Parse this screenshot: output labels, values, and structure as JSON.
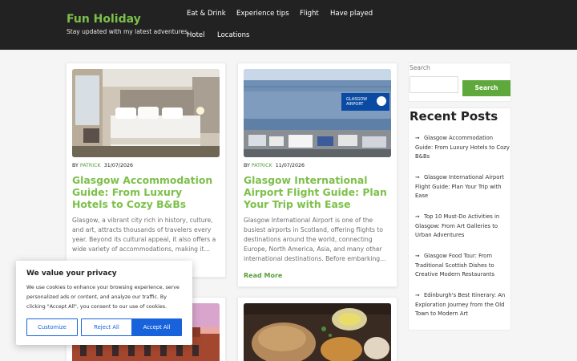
{
  "site": {
    "title": "Fun Holiday",
    "tagline": "Stay updated with my latest adventures."
  },
  "nav": {
    "items": [
      "Eat & Drink",
      "Experience tips",
      "Flight",
      "Have played",
      "Hotel",
      "Locations"
    ]
  },
  "posts": [
    {
      "by": "BY",
      "author": "PATRICK",
      "date": "31/07/2026",
      "title": "Glasgow Accommodation Guide: From Luxury Hotels to Cozy B&Bs",
      "excerpt": "Glasgow, a vibrant city rich in history, culture, and art, attracts thousands of travelers every year. Beyond its cultural appeal, it also offers a wide variety of accommodations, making it…"
    },
    {
      "by": "BY",
      "author": "PATRICK",
      "date": "11/07/2026",
      "title": "Glasgow International Airport Flight Guide: Plan Your Trip with Ease",
      "excerpt": "Glasgow International Airport is one of the busiest airports in Scotland, offering flights to destinations around the world, connecting Europe, North America, Asia, and many other international destinations. Before embarking…",
      "read_more": "Read More",
      "airport_sign": "GLASGOW AIRPORT"
    }
  ],
  "sidebar": {
    "search_label": "Search",
    "search_placeholder": "",
    "search_button": "Search",
    "recent_title": "Recent Posts",
    "recent": [
      "Glasgow Accommodation Guide: From Luxury Hotels to Cozy B&Bs",
      "Glasgow International Airport Flight Guide: Plan Your Trip with Ease",
      "Top 10 Must-Do Activities in Glasgow: From Art Galleries to Urban Adventures",
      "Glasgow Food Tour: From Traditional Scottish Dishes to Creative Modern Restaurants",
      "Edinburgh's Best Itinerary: An Exploration Journey from the Old Town to Modern Art"
    ]
  },
  "cookie": {
    "title": "We value your privacy",
    "text": "We use cookies to enhance your browsing experience, serve personalized ads or content, and analyze our traffic. By clicking \"Accept All\", you consent to our use of cookies.",
    "customize": "Customize",
    "reject": "Reject All",
    "accept": "Accept All"
  },
  "colors": {
    "header_bg": "#222222",
    "accent_green": "#7cc04a",
    "cookie_blue": "#1863dc"
  }
}
